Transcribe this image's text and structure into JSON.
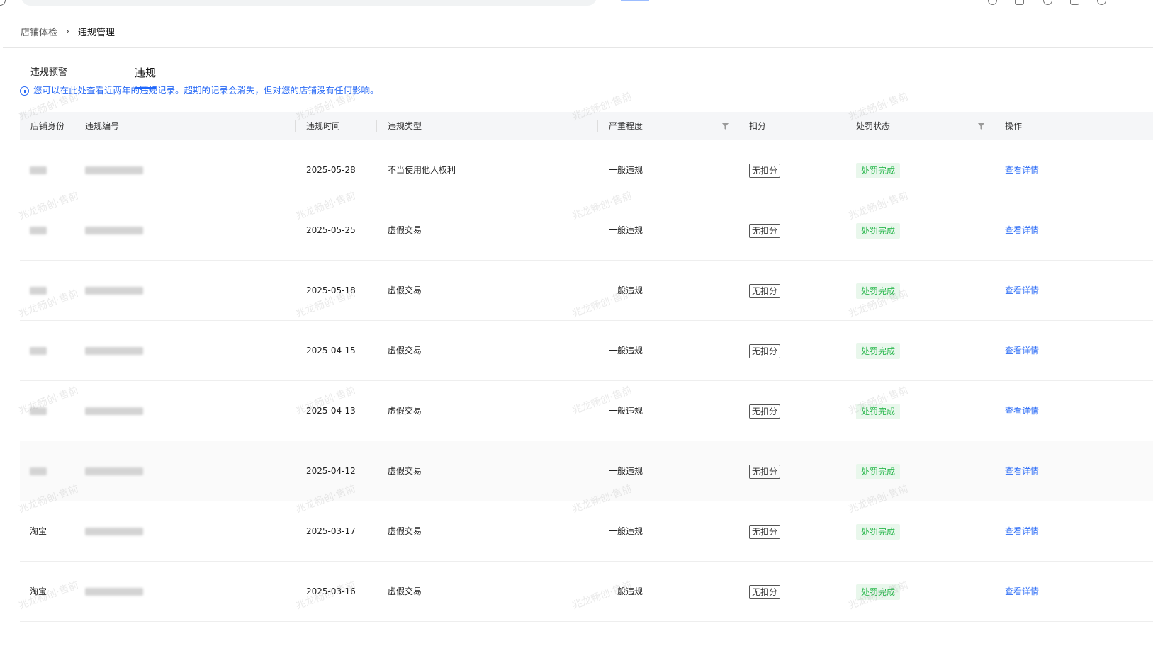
{
  "breadcrumb": {
    "parent": "店铺体检",
    "separator": "›",
    "current": "违规管理"
  },
  "tabs": [
    {
      "label": "违规预警",
      "active": false
    },
    {
      "label": "违规",
      "active": true
    }
  ],
  "notice": {
    "icon": "info-icon",
    "text": "您可以在此处查看近两年的违规记录。超期的记录会消失，但对您的店铺没有任何影响。"
  },
  "table": {
    "columns": {
      "shop_identity": "店铺身份",
      "violation_id": "违规编号",
      "violation_time": "违规时间",
      "violation_type": "违规类型",
      "severity": "严重程度",
      "deduction": "扣分",
      "penalty_status": "处罚状态",
      "action": "操作"
    },
    "rows": [
      {
        "shop": "",
        "time": "2025-05-28",
        "type": "不当使用他人权利",
        "severity": "一般违规",
        "deduction": "无扣分",
        "status": "处罚完成",
        "action": "查看详情"
      },
      {
        "shop": "",
        "time": "2025-05-25",
        "type": "虚假交易",
        "severity": "一般违规",
        "deduction": "无扣分",
        "status": "处罚完成",
        "action": "查看详情"
      },
      {
        "shop": "",
        "time": "2025-05-18",
        "type": "虚假交易",
        "severity": "一般违规",
        "deduction": "无扣分",
        "status": "处罚完成",
        "action": "查看详情"
      },
      {
        "shop": "",
        "time": "2025-04-15",
        "type": "虚假交易",
        "severity": "一般违规",
        "deduction": "无扣分",
        "status": "处罚完成",
        "action": "查看详情"
      },
      {
        "shop": "",
        "time": "2025-04-13",
        "type": "虚假交易",
        "severity": "一般违规",
        "deduction": "无扣分",
        "status": "处罚完成",
        "action": "查看详情"
      },
      {
        "shop": "",
        "time": "2025-04-12",
        "type": "虚假交易",
        "severity": "一般违规",
        "deduction": "无扣分",
        "status": "处罚完成",
        "action": "查看详情"
      },
      {
        "shop": "淘宝",
        "time": "2025-03-17",
        "type": "虚假交易",
        "severity": "一般违规",
        "deduction": "无扣分",
        "status": "处罚完成",
        "action": "查看详情"
      },
      {
        "shop": "淘宝",
        "time": "2025-03-16",
        "type": "虚假交易",
        "severity": "一般违规",
        "deduction": "无扣分",
        "status": "处罚完成",
        "action": "查看详情"
      }
    ]
  },
  "watermark": {
    "text": "兆龙畅创·售前"
  },
  "colors": {
    "link": "#2c6cf6",
    "status_bg": "#e9f7ec",
    "status_text": "#2cb84f",
    "header_bg": "#f5f6f8"
  }
}
